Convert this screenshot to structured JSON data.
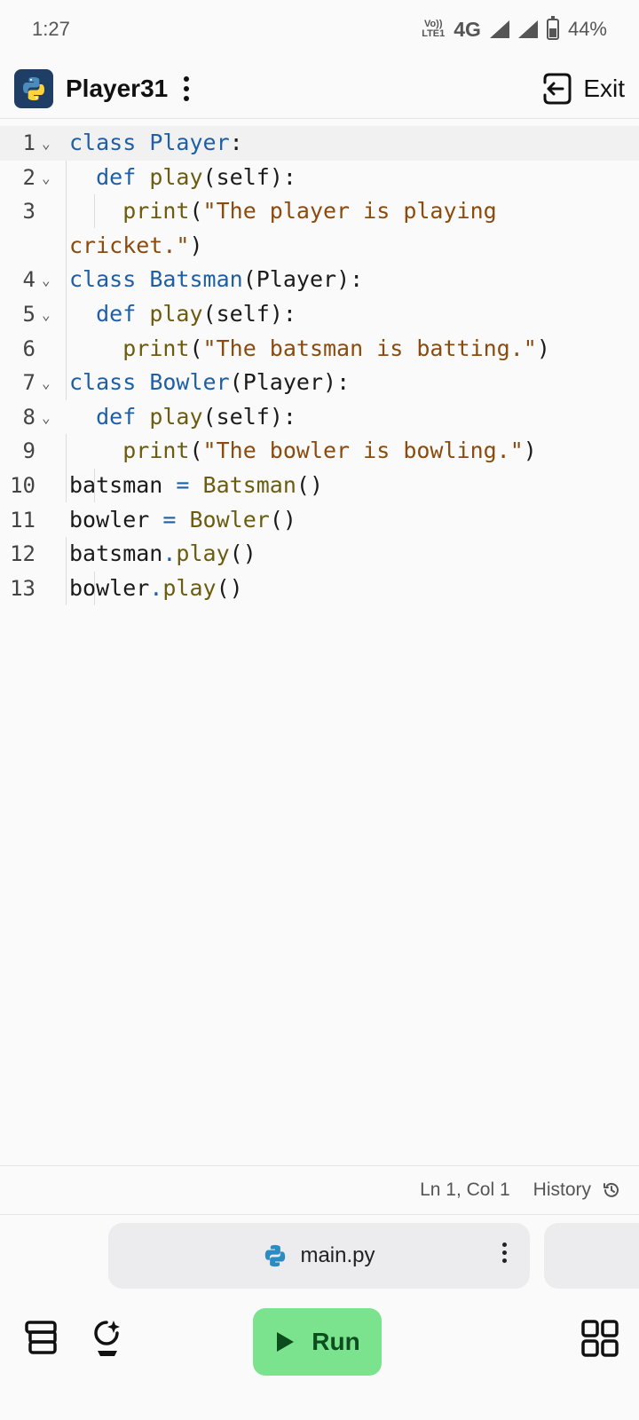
{
  "status_bar": {
    "time": "1:27",
    "volte_top": "Vo))",
    "volte_bottom": "LTE1",
    "network": "4G",
    "battery": "44%"
  },
  "header": {
    "title": "Player31",
    "exit_label": "Exit"
  },
  "editor": {
    "lines": [
      {
        "n": "1",
        "fold": "⌄"
      },
      {
        "n": "2",
        "fold": "⌄"
      },
      {
        "n": "3",
        "fold": ""
      },
      {
        "n": "",
        "fold": ""
      },
      {
        "n": "4",
        "fold": "⌄"
      },
      {
        "n": "5",
        "fold": "⌄"
      },
      {
        "n": "6",
        "fold": ""
      },
      {
        "n": "7",
        "fold": "⌄"
      },
      {
        "n": "8",
        "fold": "⌄"
      },
      {
        "n": "9",
        "fold": ""
      },
      {
        "n": "10",
        "fold": ""
      },
      {
        "n": "11",
        "fold": ""
      },
      {
        "n": "12",
        "fold": ""
      },
      {
        "n": "13",
        "fold": ""
      }
    ],
    "tokens": {
      "class": "class",
      "def": "def",
      "self": "self",
      "player": "Player",
      "batsman_cls": "Batsman",
      "bowler_cls": "Bowler",
      "play": "play",
      "print": "print",
      "str_player_a": "\"The player is playing",
      "str_player_b": "cricket.\"",
      "str_batsman": "\"The batsman is batting.\"",
      "str_bowler": "\"The bowler is bowling.\"",
      "var_batsman": "batsman",
      "var_bowler": "bowler"
    }
  },
  "status_line": {
    "cursor": "Ln 1, Col 1",
    "history_label": "History"
  },
  "file_tab": {
    "name": "main.py"
  },
  "toolbar": {
    "run_label": "Run"
  },
  "colors": {
    "keyword": "#1e5fa6",
    "function": "#6b5c10",
    "string": "#8b4b0d",
    "run_button": "#7be38e"
  }
}
